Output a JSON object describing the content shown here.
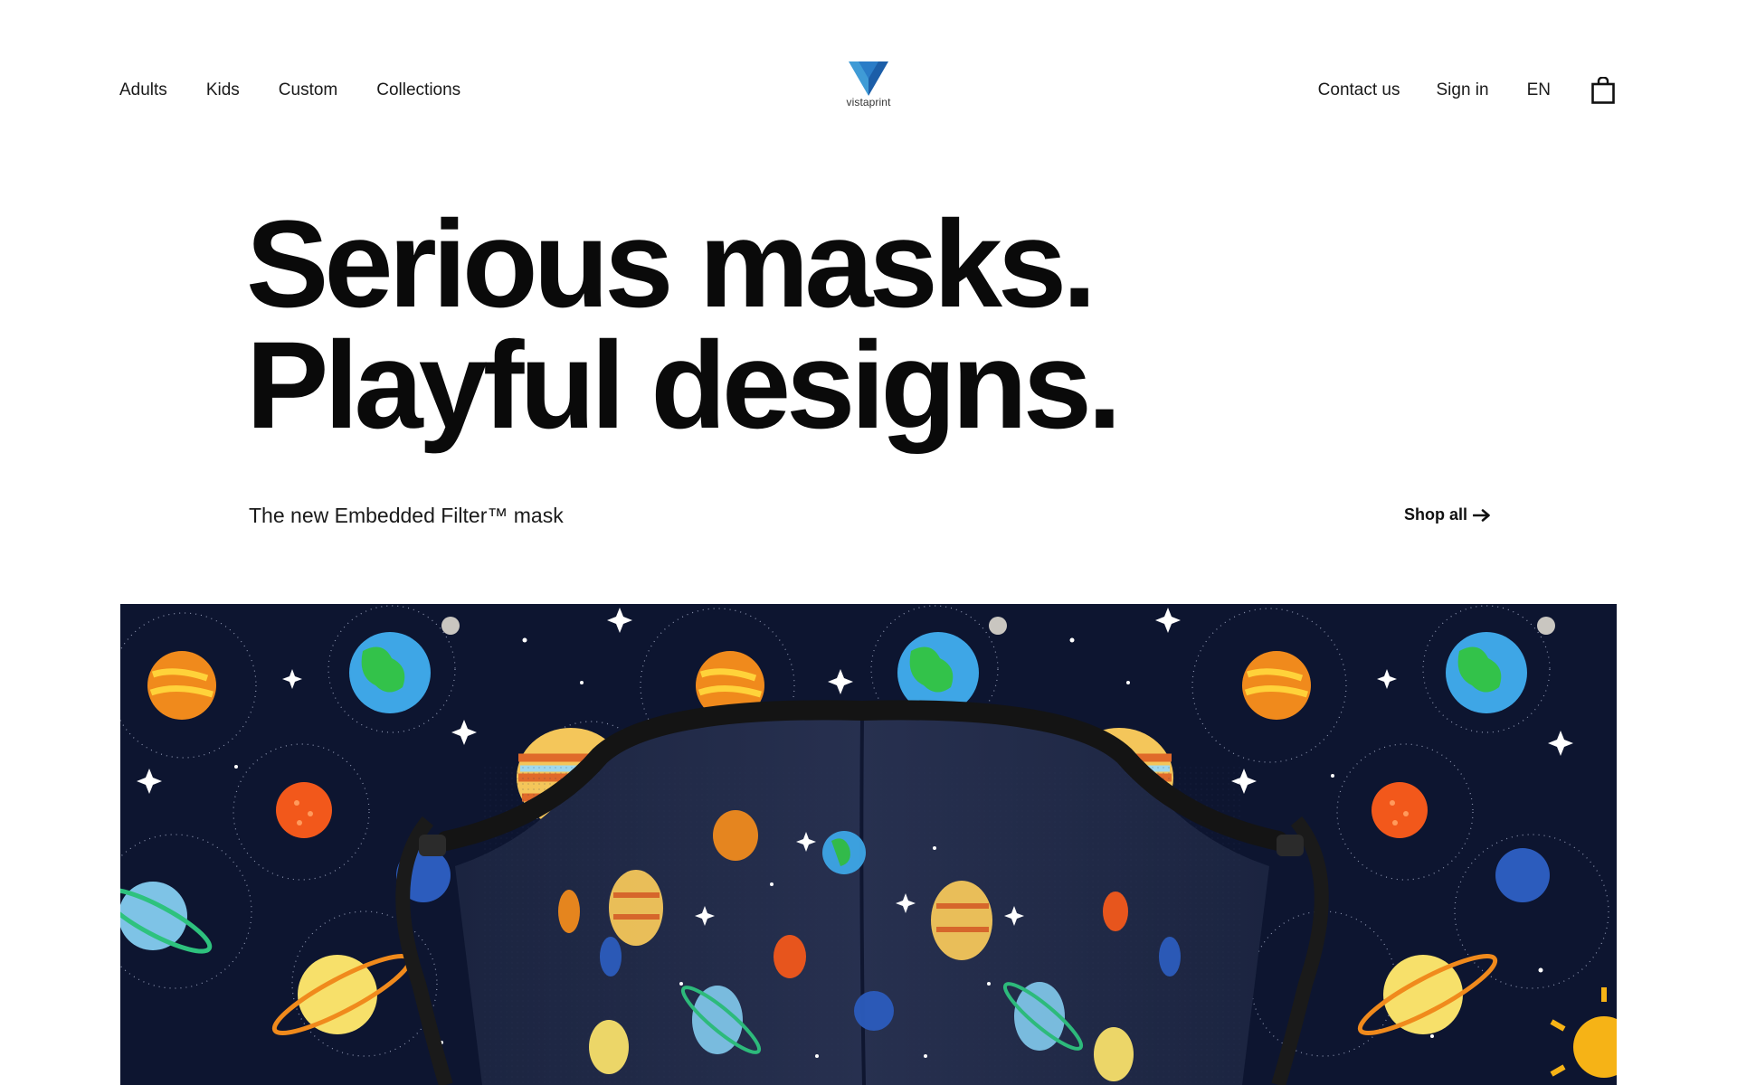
{
  "nav": {
    "left": [
      {
        "label": "Adults"
      },
      {
        "label": "Kids"
      },
      {
        "label": "Custom"
      },
      {
        "label": "Collections"
      }
    ],
    "right": {
      "contact": "Contact us",
      "signin": "Sign in",
      "language": "EN"
    }
  },
  "logo": {
    "text": "vistaprint",
    "icon": "vistaprint-logo-icon"
  },
  "hero": {
    "title_line1": "Serious masks.",
    "title_line2": "Playful designs.",
    "subtitle": "The new Embedded Filter™ mask",
    "cta": "Shop all"
  },
  "banner": {
    "image": "face-mask-with-space-planets-pattern",
    "background_color": "#0d1530"
  },
  "icons": {
    "cart": "shopping-bag-icon",
    "arrow": "arrow-right-icon"
  }
}
